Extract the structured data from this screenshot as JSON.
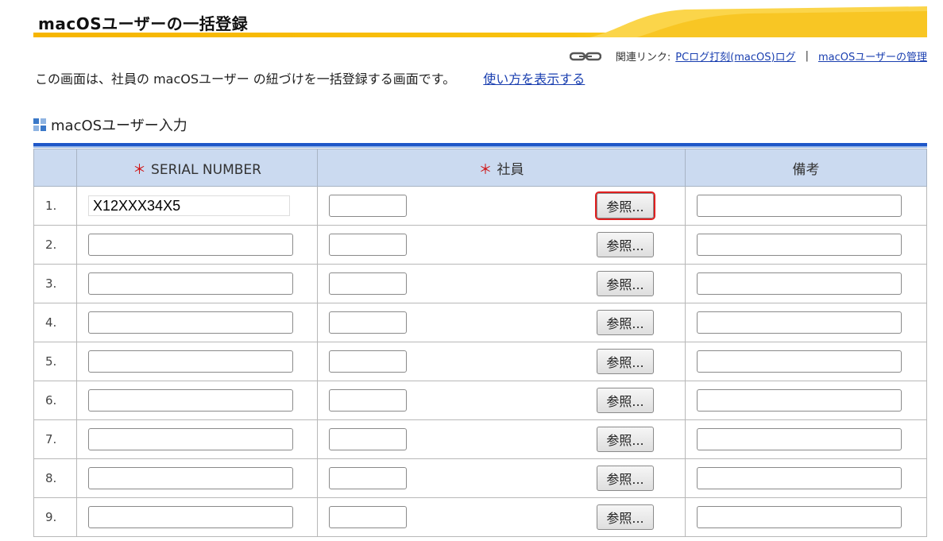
{
  "header": {
    "title": "macOSユーザーの一括登録"
  },
  "links": {
    "prefix": "関連リンク:",
    "link1": "PCログ打刻(macOS)ログ",
    "separator": "|",
    "link2": "macOSユーザーの管理"
  },
  "intro": {
    "text": "この画面は、社員の macOSユーザー の紐づけを一括登録する画面です。",
    "help_link": "使い方を表示する"
  },
  "section": {
    "title": "macOSユーザー入力"
  },
  "table": {
    "required_mark": "＊",
    "col_serial": "SERIAL NUMBER",
    "col_employee": "社員",
    "col_note": "備考",
    "ref_label": "参照...",
    "rows": [
      {
        "num": "1.",
        "serial": "X12XXX34X5"
      },
      {
        "num": "2.",
        "serial": ""
      },
      {
        "num": "3.",
        "serial": ""
      },
      {
        "num": "4.",
        "serial": ""
      },
      {
        "num": "5.",
        "serial": ""
      },
      {
        "num": "6.",
        "serial": ""
      },
      {
        "num": "7.",
        "serial": ""
      },
      {
        "num": "8.",
        "serial": ""
      },
      {
        "num": "9.",
        "serial": ""
      }
    ]
  },
  "colors": {
    "header_gradient": "#f5b400",
    "table_header_bg": "#cbdaf0",
    "rule_blue": "#1f57c8",
    "link_blue": "#1a3fb0",
    "required_red": "#d01010",
    "highlight_red": "#e02020"
  }
}
